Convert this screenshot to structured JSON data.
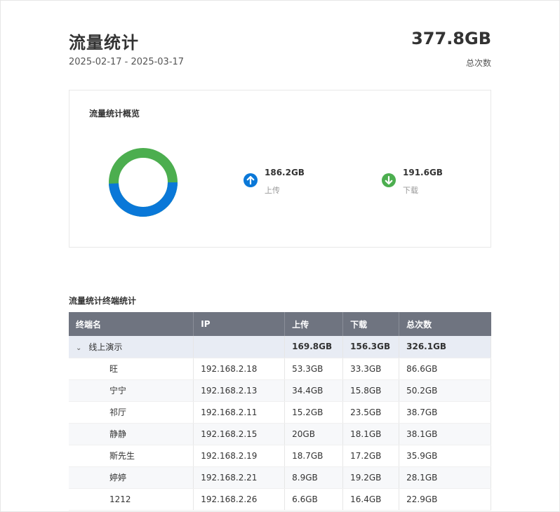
{
  "header": {
    "title": "流量统计",
    "date_range": "2025-02-17 - 2025-03-17",
    "total_value": "377.8GB",
    "total_label": "总次数"
  },
  "overview": {
    "title": "流量统计概览",
    "upload": {
      "value": "186.2GB",
      "label": "上传",
      "icon": "arrow-up-icon",
      "color": "#0a78d8"
    },
    "download": {
      "value": "191.6GB",
      "label": "下载",
      "icon": "arrow-down-icon",
      "color": "#4cae4f"
    },
    "donut": {
      "upload_gb": 186.2,
      "download_gb": 191.6
    }
  },
  "terminals": {
    "title": "流量统计终端统计",
    "columns": [
      "终端名",
      "IP",
      "上传",
      "下载",
      "总次数"
    ],
    "group": {
      "name": "线上演示",
      "ip": "",
      "upload": "169.8GB",
      "download": "156.3GB",
      "total": "326.1GB"
    },
    "rows": [
      {
        "name": "旺",
        "ip": "192.168.2.18",
        "upload": "53.3GB",
        "download": "33.3GB",
        "total": "86.6GB"
      },
      {
        "name": "宁宁",
        "ip": "192.168.2.13",
        "upload": "34.4GB",
        "download": "15.8GB",
        "total": "50.2GB"
      },
      {
        "name": "祁厅",
        "ip": "192.168.2.11",
        "upload": "15.2GB",
        "download": "23.5GB",
        "total": "38.7GB"
      },
      {
        "name": "静静",
        "ip": "192.168.2.15",
        "upload": "20GB",
        "download": "18.1GB",
        "total": "38.1GB"
      },
      {
        "name": "斯先生",
        "ip": "192.168.2.19",
        "upload": "18.7GB",
        "download": "17.2GB",
        "total": "35.9GB"
      },
      {
        "name": "婷婷",
        "ip": "192.168.2.21",
        "upload": "8.9GB",
        "download": "19.2GB",
        "total": "28.1GB"
      },
      {
        "name": "1212",
        "ip": "192.168.2.26",
        "upload": "6.6GB",
        "download": "16.4GB",
        "total": "22.9GB"
      }
    ]
  }
}
